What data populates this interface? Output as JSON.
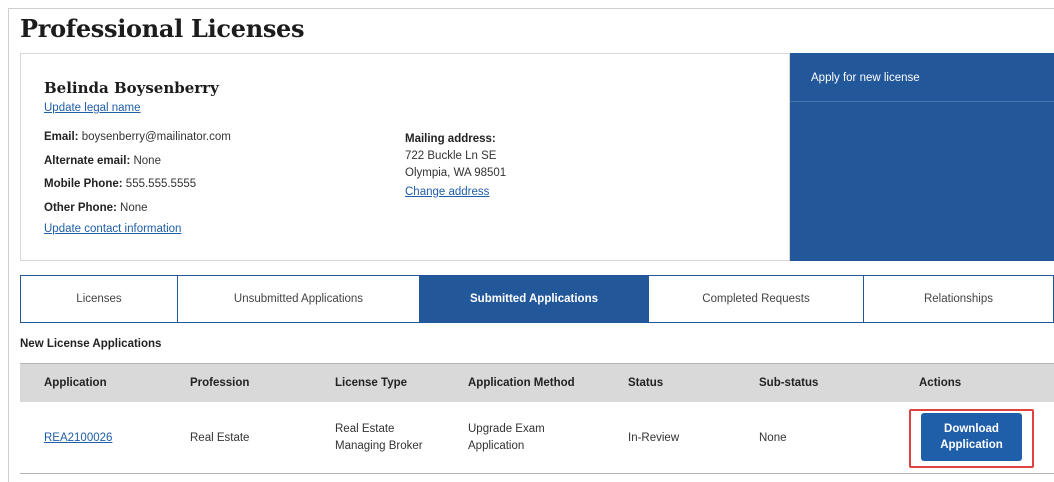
{
  "page": {
    "title": "Professional Licenses"
  },
  "profile": {
    "name": "Belinda Boysenberry",
    "update_name_link": "Update legal name",
    "contact": [
      {
        "label": "Email:",
        "value": "boysenberry@mailinator.com"
      },
      {
        "label": "Alternate email:",
        "value": "None"
      },
      {
        "label": "Mobile Phone:",
        "value": "555.555.5555"
      },
      {
        "label": "Other Phone:",
        "value": "None"
      }
    ],
    "update_contact_link": "Update contact information",
    "mailing": {
      "label": "Mailing address:",
      "line1": "722 Buckle Ln SE",
      "line2": "Olympia, WA 98501",
      "change_link": "Change address"
    }
  },
  "apply_panel": {
    "apply_link": "Apply for new license"
  },
  "tabs": [
    {
      "label": "Licenses",
      "active": false
    },
    {
      "label": "Unsubmitted Applications",
      "active": false
    },
    {
      "label": "Submitted Applications",
      "active": true
    },
    {
      "label": "Completed Requests",
      "active": false
    },
    {
      "label": "Relationships",
      "active": false
    }
  ],
  "section": {
    "heading": "New License Applications",
    "columns": [
      "Application",
      "Profession",
      "License Type",
      "Application Method",
      "Status",
      "Sub-status",
      "Actions"
    ],
    "rows": [
      {
        "application": "REA2100026",
        "profession": "Real Estate",
        "license_type": "Real Estate Managing Broker",
        "method": "Upgrade Exam Application",
        "status": "In-Review",
        "sub_status": "None",
        "action_label": "Download\nApplication"
      }
    ]
  },
  "colors": {
    "primary": "#22579a",
    "link": "#1f5ea8",
    "highlight": "#e0423e",
    "header_bg": "#d9d9d9"
  }
}
